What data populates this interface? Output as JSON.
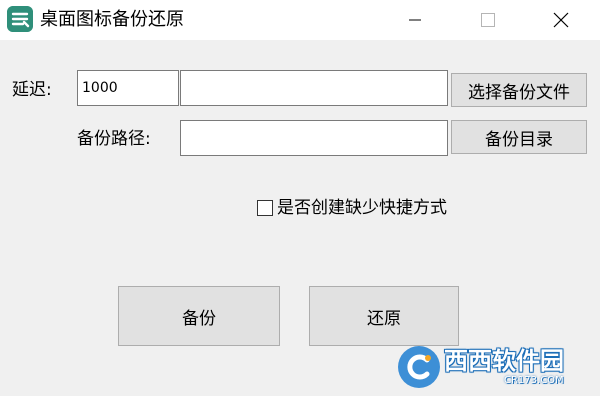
{
  "window": {
    "title": "桌面图标备份还原",
    "icon": "app-logo-icon",
    "controls": [
      "minimize-icon",
      "maximize-icon",
      "close-icon"
    ]
  },
  "form": {
    "delay_label": "延迟:",
    "delay_value": "1000",
    "backup_file_value": "",
    "select_backup_file_button": "选择备份文件",
    "backup_path_label": "备份路径:",
    "backup_path_value": "",
    "backup_dir_button": "备份目录",
    "create_missing_shortcuts_label": "是否创建缺少快捷方式",
    "create_missing_shortcuts_checked": false
  },
  "actions": {
    "backup_button": "备份",
    "restore_button": "还原"
  },
  "watermark": {
    "title": "西西软件园",
    "sub": "CR173.COM"
  },
  "colors": {
    "app_icon": "#2f8f7a",
    "watermark": "#3d8fd6"
  }
}
